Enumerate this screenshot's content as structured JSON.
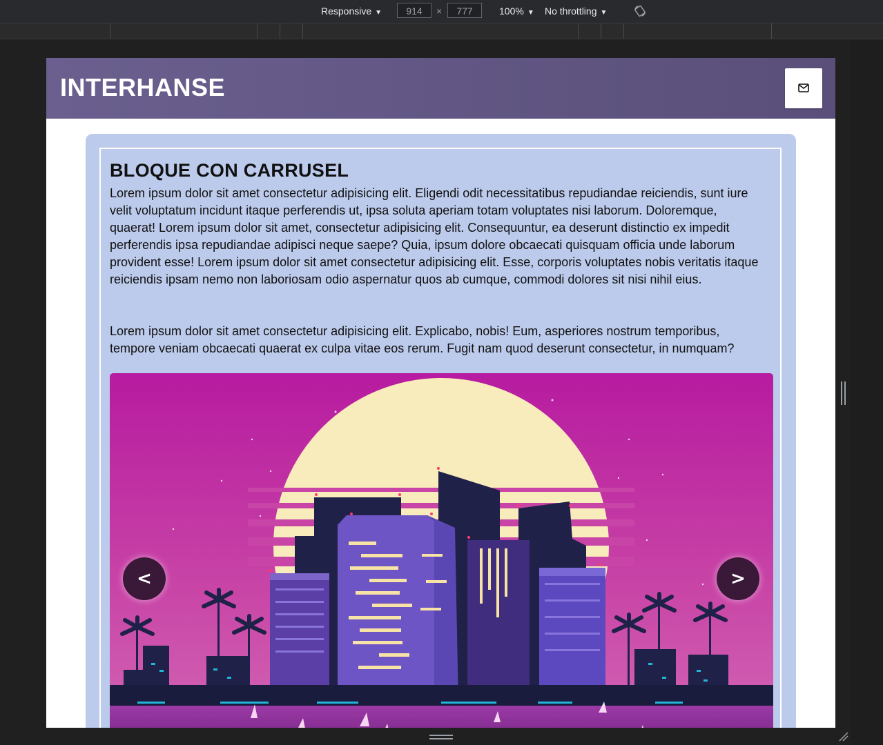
{
  "devtools": {
    "device_mode": "Responsive",
    "width": "914",
    "height": "777",
    "times": "×",
    "zoom": "100%",
    "throttling": "No throttling"
  },
  "header": {
    "brand": "INTERHANSE",
    "mail_icon": "envelope-icon",
    "background": "#5a4f7a"
  },
  "card": {
    "title": "BLOQUE CON CARRUSEL",
    "paragraph_1": "Lorem ipsum dolor sit amet consectetur adipisicing elit. Eligendi odit necessitatibus repudiandae reiciendis, sunt iure velit voluptatum incidunt itaque perferendis ut, ipsa soluta aperiam totam voluptates nisi laborum. Doloremque, quaerat! Lorem ipsum dolor sit amet, consectetur adipisicing elit. Consequuntur, ea deserunt distinctio ex impedit perferendis ipsa repudiandae adipisci neque saepe? Quia, ipsum dolore obcaecati quisquam officia unde laborum provident esse! Lorem ipsum dolor sit amet consectetur adipisicing elit. Esse, corporis voluptates nobis veritatis itaque reiciendis ipsam nemo non laboriosam odio aspernatur quos ab cumque, commodi dolores sit nisi nihil eius.",
    "paragraph_2": "Lorem ipsum dolor sit amet consectetur adipisicing elit. Explicabo, nobis! Eum, asperiores nostrum temporibus, tempore veniam obcaecati quaerat ex culpa vitae eos rerum. Fugit nam quod deserunt consectetur, in numquam?",
    "background": "#bccaeb"
  },
  "carousel": {
    "prev_label": "<",
    "next_label": ">",
    "image": "synthwave-city-skyline"
  }
}
